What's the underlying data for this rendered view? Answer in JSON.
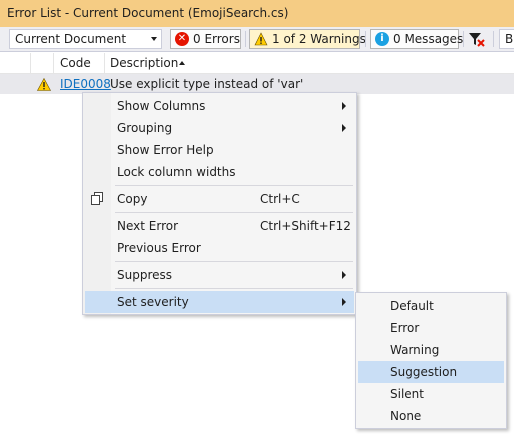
{
  "window": {
    "title": "Error List - Current Document (EmojiSearch.cs)"
  },
  "toolbar": {
    "scope_value": "Current Document",
    "errors_label": "0 Errors",
    "warnings_label": "1 of 2 Warnings",
    "messages_label": "0 Messages",
    "build_label": "B"
  },
  "table": {
    "columns": [
      "Code",
      "Description"
    ],
    "rows": [
      {
        "code": "IDE0008",
        "description": "Use explicit type instead of 'var'"
      }
    ]
  },
  "context_menu": {
    "items": [
      {
        "label": "Show Columns",
        "shortcut": ""
      },
      {
        "label": "Grouping",
        "shortcut": ""
      },
      {
        "label": "Show Error Help",
        "shortcut": ""
      },
      {
        "label": "Lock column widths",
        "shortcut": ""
      },
      {
        "label": "Copy",
        "shortcut": "Ctrl+C"
      },
      {
        "label": "Next Error",
        "shortcut": "Ctrl+Shift+F12"
      },
      {
        "label": "Previous Error",
        "shortcut": ""
      },
      {
        "label": "Suppress",
        "shortcut": ""
      },
      {
        "label": "Set severity",
        "shortcut": ""
      }
    ]
  },
  "severity_menu": {
    "items": [
      "Default",
      "Error",
      "Warning",
      "Suggestion",
      "Silent",
      "None"
    ]
  },
  "colors": {
    "title_bar": "#f5cc84",
    "menu_highlight": "#c9def5",
    "link": "#0e70c0",
    "warning": "#ffcc00",
    "error": "#e51400",
    "info": "#1ba1e2"
  },
  "icons": [
    "error-icon",
    "warning-icon",
    "info-icon",
    "filter-icon",
    "copy-icon",
    "submenu-arrow-icon",
    "dropdown-chevron-icon"
  ]
}
